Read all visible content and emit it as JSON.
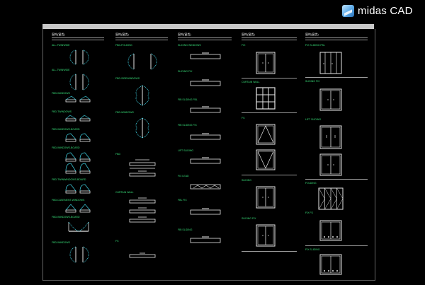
{
  "brand": {
    "text": "midas CAD",
    "icon": "midas-logo-icon"
  },
  "columns": [
    {
      "title": "窗构(窗类)",
      "labels": [
        "ALL-TWINWIDE",
        "ALL-TWINWIDE",
        "FBD-WINDOWS",
        "FBD-TWINDOWS",
        "FBD-WINDOWS-BOARD",
        "FBD-WINDOWS-BOARD",
        "FBD-TWINWINDOWS-BOARD",
        "FBD-CASEMENT-WINDOWS",
        "FBD-WINDOWS-BOARD",
        "FBD-WINDOWS"
      ]
    },
    {
      "title": "窗构(窗类)",
      "labels": [
        "FBD-FOLDING",
        "FBD-SIDEWINDOWS",
        "FBD-WINDOWS",
        "FBD",
        "CURTAIN WALL",
        "FS"
      ]
    },
    {
      "title": "窗构(窗类)",
      "labels": [
        "SLIDING WINDOWS",
        "SLIDING FIX",
        "FBI SLIDING FBL",
        "FBI SLIDING FIX",
        "LIFT SLIDING",
        "FIX LEAD",
        "FBL FIX",
        "FBI SLIDING"
      ]
    },
    {
      "title": "窗构(窗类)",
      "labels": [
        "FIX",
        "CURTAIN WALL",
        "FS",
        "SLIDING",
        "SLIDING FIX"
      ]
    },
    {
      "title": "窗构(窗类)",
      "labels": [
        "FIX SLIDING FBL",
        "SLIDING FIX",
        "LIFT SLIDING",
        "FOLDING",
        "FIX FS",
        "FIX SLIDING"
      ]
    }
  ],
  "colors": {
    "background": "#000000",
    "symbol_cyan": "#3ecfe0",
    "symbol_white": "#e6e6e6",
    "label_green": "#39e07a",
    "titlebar": "#c8c8c8"
  }
}
